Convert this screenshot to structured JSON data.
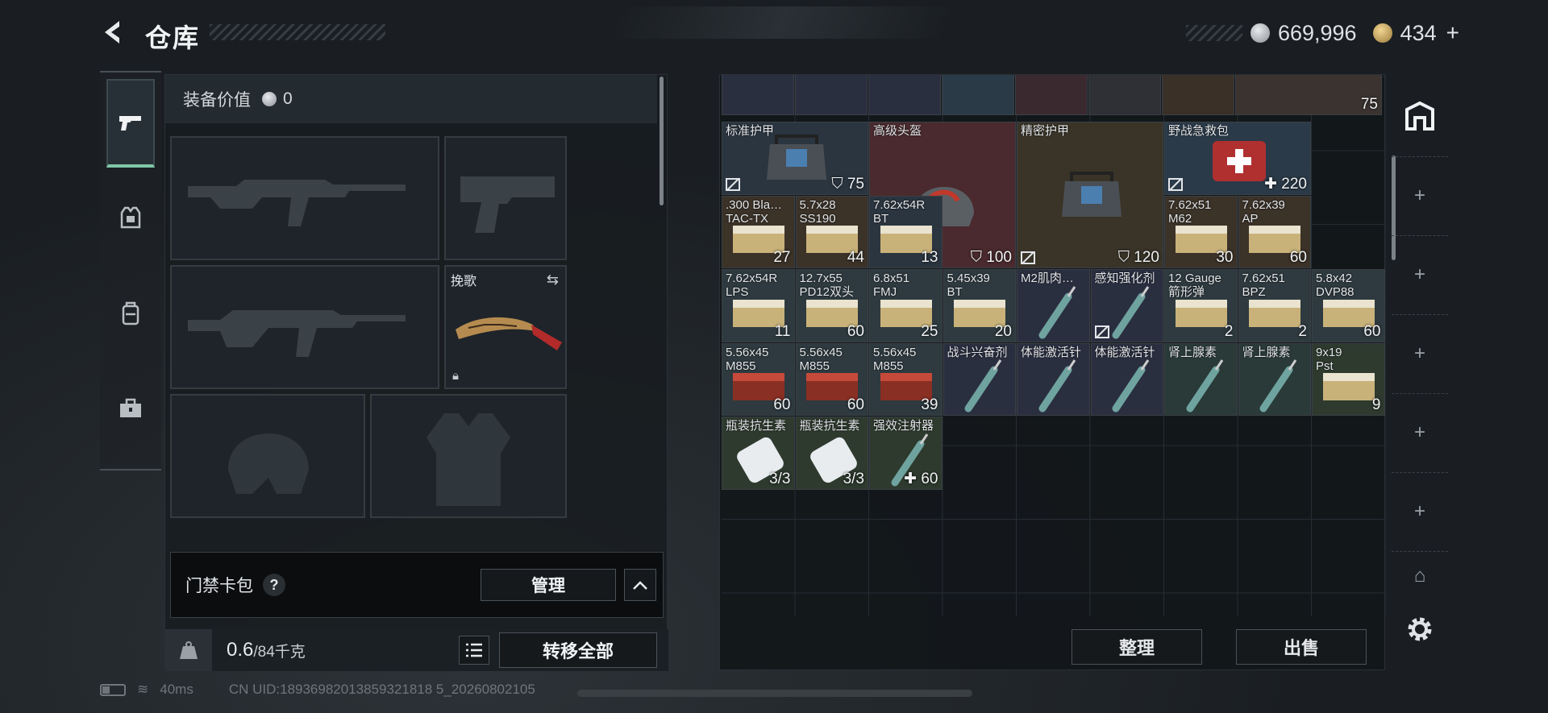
{
  "header": {
    "title": "仓库",
    "currency_silver": "669,996",
    "currency_gold": "434",
    "add_label": "+"
  },
  "loadout": {
    "equip_value_label": "装备价值",
    "equip_value": "0",
    "melee_label": "挽歌",
    "keycard_title": "门禁卡包",
    "help_label": "?",
    "manage_label": "管理",
    "weight_value": "0.6",
    "weight_max": "/84千克",
    "transfer_all_label": "转移全部"
  },
  "stash": {
    "sort_label": "整理",
    "sell_label": "出售",
    "top_row_counts": [
      "75"
    ],
    "items": [
      {
        "name": "标准护甲",
        "count": "75",
        "prefix": "shield",
        "nobind": true
      },
      {
        "name": "高级头盔",
        "count": "100",
        "prefix": "shield",
        "nobind": false
      },
      {
        "name": "精密护甲",
        "count": "120",
        "prefix": "shield",
        "nobind": true
      },
      {
        "name": "野战急救包",
        "count": "220",
        "prefix": "plus",
        "nobind": true
      },
      {
        "name": ".300 Bla…\nTAC-TX",
        "count": "27"
      },
      {
        "name": "5.7x28\nSS190",
        "count": "44"
      },
      {
        "name": "7.62x54R\nBT",
        "count": "13"
      },
      {
        "name": "7.62x51\nM62",
        "count": "30"
      },
      {
        "name": "7.62x39\nAP",
        "count": "60"
      },
      {
        "name": "7.62x54R\nLPS",
        "count": "11"
      },
      {
        "name": "12.7x55\nPD12双头",
        "count": "60"
      },
      {
        "name": "6.8x51\nFMJ",
        "count": "25"
      },
      {
        "name": "5.45x39\nBT",
        "count": "20"
      },
      {
        "name": "M2肌肉…",
        "count": ""
      },
      {
        "name": "感知强化剂",
        "count": "",
        "nobind": true
      },
      {
        "name": "12 Gauge\n箭形弹",
        "count": "2"
      },
      {
        "name": "7.62x51\nBPZ",
        "count": "2"
      },
      {
        "name": "5.8x42\nDVP88",
        "count": "60"
      },
      {
        "name": "5.56x45\nM855",
        "count": "60"
      },
      {
        "name": "5.56x45\nM855",
        "count": "60"
      },
      {
        "name": "5.56x45\nM855",
        "count": "39"
      },
      {
        "name": "战斗兴奋剂",
        "count": ""
      },
      {
        "name": "体能激活针",
        "count": ""
      },
      {
        "name": "体能激活针",
        "count": ""
      },
      {
        "name": "肾上腺素",
        "count": ""
      },
      {
        "name": "肾上腺素",
        "count": ""
      },
      {
        "name": "9x19\nPst",
        "count": "9"
      },
      {
        "name": "瓶装抗生素",
        "count": "3/3"
      },
      {
        "name": "瓶装抗生素",
        "count": "3/3"
      },
      {
        "name": "强效注射器",
        "count": "60",
        "prefix": "plus"
      }
    ]
  },
  "status_bar": {
    "ping": "40ms",
    "uid": "CN UID:18936982013859321818 5_20260802105"
  },
  "colors": {
    "accent": "#7fc6a7",
    "panel": "#1e2429",
    "red_tint": "#4a2a2e",
    "ammo_tint": "#2e3a3f"
  }
}
